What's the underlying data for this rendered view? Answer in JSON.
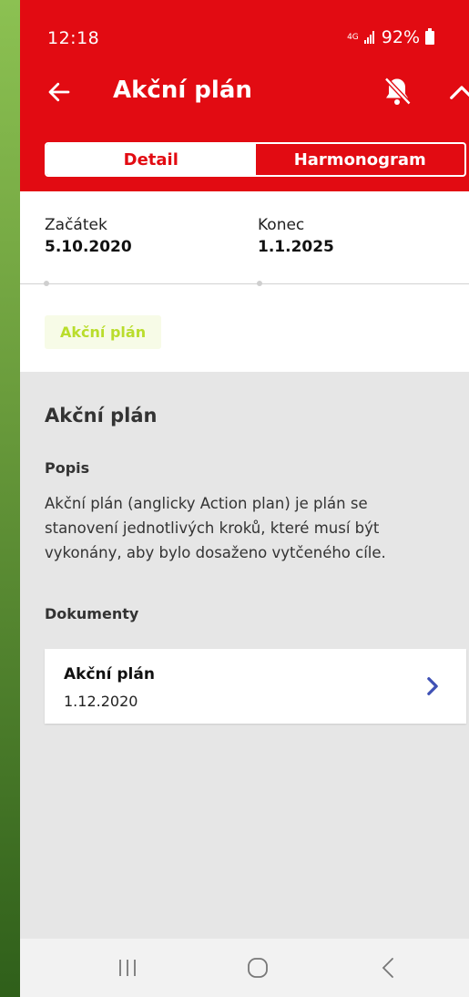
{
  "status": {
    "time": "12:18",
    "network": "4G",
    "battery": "92%"
  },
  "header": {
    "title": "Akční plán",
    "back_icon": "arrow-left-icon",
    "notif_icon": "bell-off-icon",
    "collapse_icon": "chevron-up-icon"
  },
  "tabs": [
    {
      "label": "Detail",
      "active": true
    },
    {
      "label": "Harmonogram",
      "active": false
    }
  ],
  "dates": {
    "start_label": "Začátek",
    "start_value": "5.10.2020",
    "end_label": "Konec",
    "end_value": "1.1.2025"
  },
  "badge": "Akční plán",
  "section": {
    "title": "Akční plán",
    "desc_label": "Popis",
    "desc_text": "Akční plán (anglicky Action plan) je plán se stanovení jednotlivých kroků, které musí být vykonány, aby bylo dosaženo vytčeného cíle.",
    "docs_label": "Dokumenty"
  },
  "documents": [
    {
      "name": "Akční plán",
      "date": "1.12.2020"
    }
  ],
  "colors": {
    "brand": "#e20b12",
    "badge_text": "#b9dd2c",
    "badge_bg": "#f7fbe7",
    "chevron": "#3f51b5"
  }
}
